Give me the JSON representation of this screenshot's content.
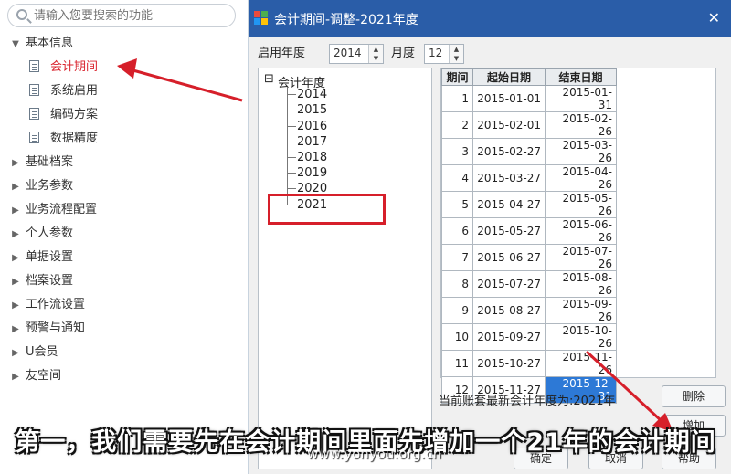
{
  "sidebar": {
    "search_placeholder": "请输入您要搜索的功能",
    "groups": [
      {
        "label": "基本信息",
        "expanded": true,
        "children": [
          "会计期间",
          "系统启用",
          "编码方案",
          "数据精度"
        ]
      },
      {
        "label": "基础档案"
      },
      {
        "label": "业务参数"
      },
      {
        "label": "业务流程配置"
      },
      {
        "label": "个人参数"
      },
      {
        "label": "单据设置"
      },
      {
        "label": "档案设置"
      },
      {
        "label": "工作流设置"
      },
      {
        "label": "预警与通知"
      },
      {
        "label": "U会员"
      },
      {
        "label": "友空间"
      }
    ]
  },
  "dialog": {
    "title": "会计期间-调整-2021年度",
    "start_year_label": "启用年度",
    "start_year_value": "2014",
    "month_label": "月度",
    "month_value": "12",
    "tree_root": "会计年度",
    "years": [
      "2014",
      "2015",
      "2016",
      "2017",
      "2018",
      "2019",
      "2020",
      "2021"
    ],
    "table_headers": [
      "期间",
      "起始日期",
      "结束日期"
    ],
    "periods": [
      [
        "1",
        "2015-01-01",
        "2015-01-31"
      ],
      [
        "2",
        "2015-02-01",
        "2015-02-26"
      ],
      [
        "3",
        "2015-02-27",
        "2015-03-26"
      ],
      [
        "4",
        "2015-03-27",
        "2015-04-26"
      ],
      [
        "5",
        "2015-04-27",
        "2015-05-26"
      ],
      [
        "6",
        "2015-05-27",
        "2015-06-26"
      ],
      [
        "7",
        "2015-06-27",
        "2015-07-26"
      ],
      [
        "8",
        "2015-07-27",
        "2015-08-26"
      ],
      [
        "9",
        "2015-08-27",
        "2015-09-26"
      ],
      [
        "10",
        "2015-09-27",
        "2015-10-26"
      ],
      [
        "11",
        "2015-10-27",
        "2015-11-26"
      ],
      [
        "12",
        "2015-11-27",
        "2015-12-31"
      ]
    ],
    "status_text": "当前账套最新会计年度为:2021年",
    "delete_label": "删除",
    "add_label": "增加",
    "ok_label": "确定",
    "cancel_label": "取消",
    "help_label": "帮助"
  },
  "subtitle": "第一，我们需要先在会计期间里面先增加一个21年的会计期间",
  "watermark": "www.yonyou.org.cn",
  "colors": {
    "titlebar": "#2a5da8",
    "accent_red": "#d61f2a",
    "selection": "#2d79d6"
  }
}
